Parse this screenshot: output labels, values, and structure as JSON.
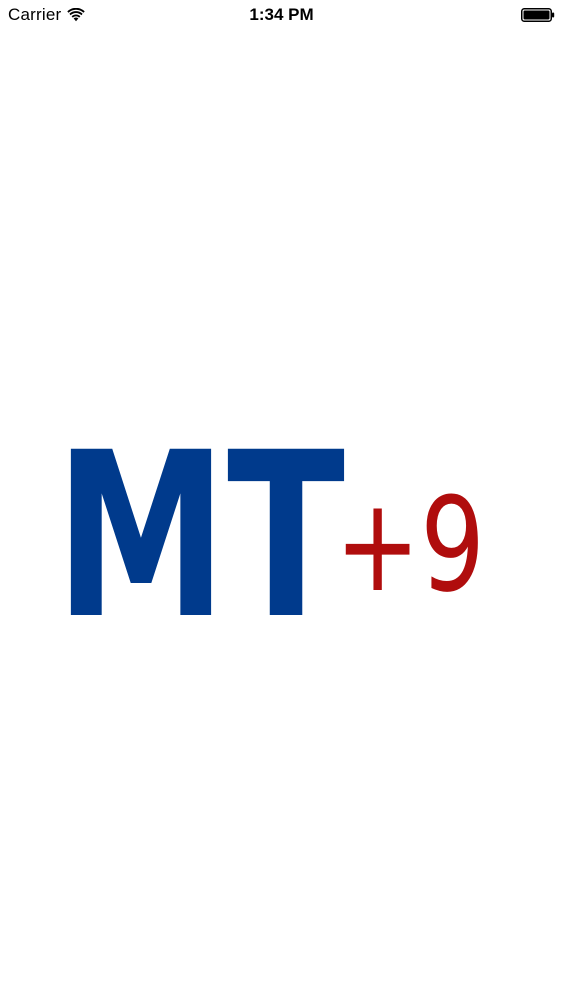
{
  "status_bar": {
    "carrier": "Carrier",
    "time": "1:34 PM",
    "wifi_icon": "wifi-icon",
    "battery_icon": "battery-full-icon"
  },
  "splash": {
    "logo": {
      "letters": "MT",
      "suffix": "+9",
      "letters_color": "#003a8c",
      "suffix_color": "#b00d0d"
    }
  }
}
